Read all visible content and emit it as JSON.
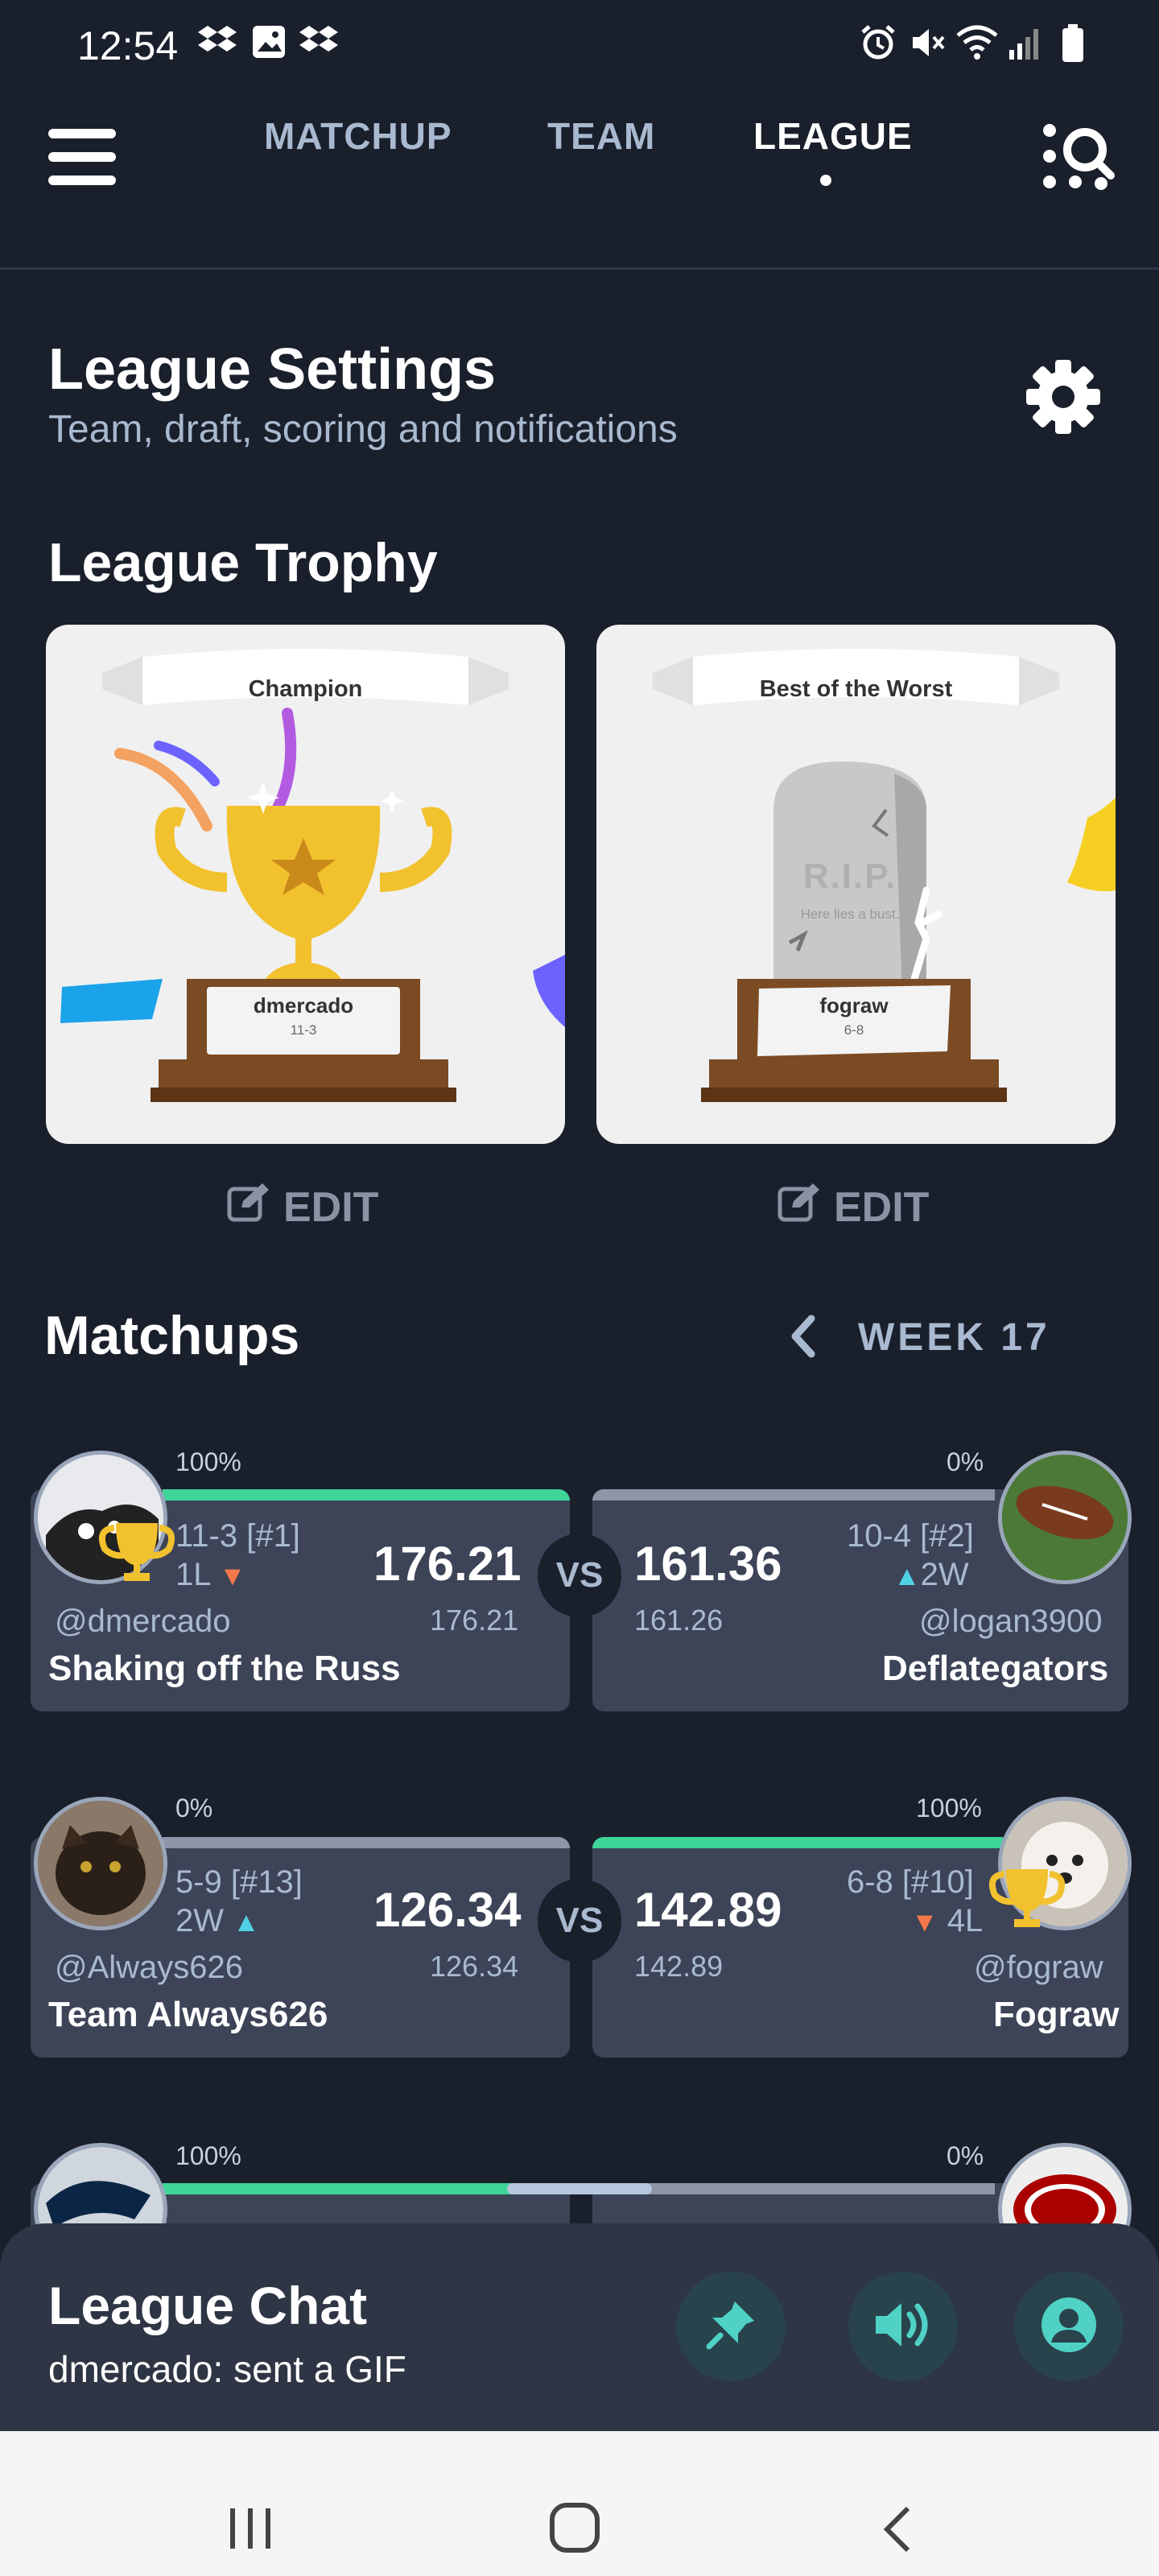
{
  "status_bar": {
    "time": "12:54"
  },
  "nav": {
    "tabs": [
      "MATCHUP",
      "TEAM",
      "LEAGUE"
    ],
    "active_tab": "LEAGUE"
  },
  "league_settings": {
    "title": "League Settings",
    "subtitle": "Team, draft, scoring and notifications"
  },
  "trophy": {
    "title": "League Trophy",
    "cards": [
      {
        "banner": "Champion",
        "name": "dmercado",
        "record": "11-3"
      },
      {
        "banner": "Best of the Worst",
        "name": "fograw",
        "record": "6-8",
        "tombstone_title": "R.I.P.",
        "tombstone_text": "Here lies a bust."
      }
    ],
    "edit_label": "EDIT"
  },
  "matchups": {
    "title": "Matchups",
    "week_label": "WEEK 17",
    "vs_label": "VS",
    "games": [
      {
        "left": {
          "pct": "100%",
          "record": "11-3 [#1]",
          "streak": "1L",
          "score": "176.21",
          "projected": "176.21",
          "handle": "@dmercado",
          "team": "Shaking off the Russ",
          "progress": 1.0
        },
        "right": {
          "pct": "0%",
          "record": "10-4 [#2]",
          "streak": "2W",
          "score": "161.36",
          "projected": "161.26",
          "handle": "@logan3900",
          "team": "Deflategators",
          "progress": 0.0
        }
      },
      {
        "left": {
          "pct": "0%",
          "record": "5-9 [#13]",
          "streak": "2W",
          "score": "126.34",
          "projected": "126.34",
          "handle": "@Always626",
          "team": "Team Always626",
          "progress": 0.0
        },
        "right": {
          "pct": "100%",
          "record": "6-8 [#10]",
          "streak": "4L",
          "score": "142.89",
          "projected": "142.89",
          "handle": "@fograw",
          "team": "Fograw",
          "progress": 1.0
        }
      },
      {
        "left": {
          "pct": "100%"
        },
        "right": {
          "pct": "0%"
        }
      }
    ]
  },
  "chat": {
    "title": "League Chat",
    "last_message": "dmercado: sent a GIF"
  },
  "colors": {
    "background": "#1a1f2c",
    "card": "#3d4457",
    "win_bar": "#3ed598",
    "accent_teal": "#4fd1c5",
    "loss_arrow": "#f4794a"
  }
}
